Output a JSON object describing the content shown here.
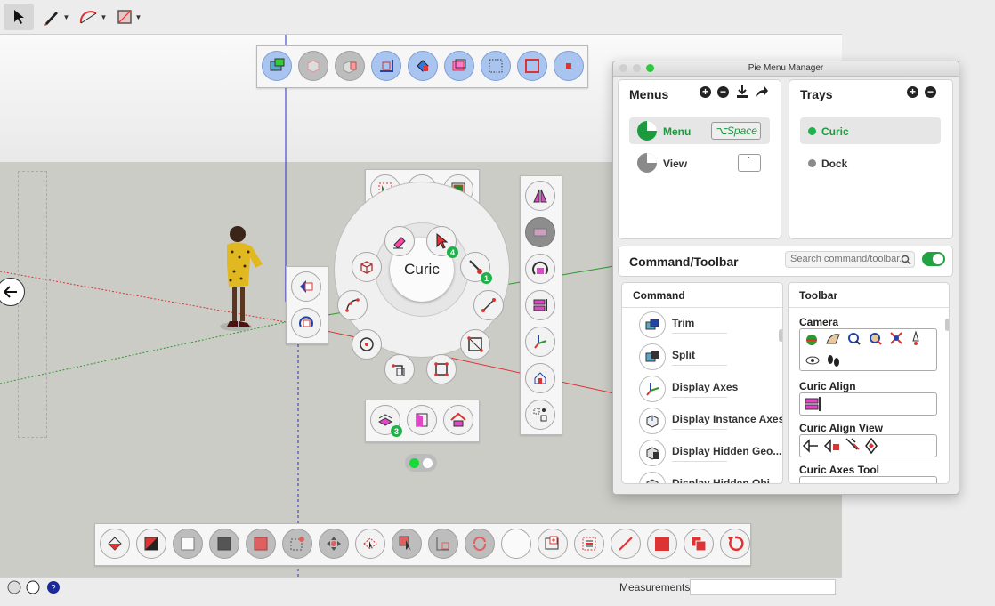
{
  "pie": {
    "center_label": "Curic"
  },
  "status_bar": {
    "measurements_label": "Measurements",
    "measurements_value": ""
  },
  "manager": {
    "window_title": "Pie Menu Manager",
    "menus": {
      "title": "Menus",
      "items": [
        {
          "label": "Menu",
          "shortcut": "⌥Space",
          "selected": true
        },
        {
          "label": "View",
          "shortcut": "`",
          "selected": false
        }
      ]
    },
    "trays": {
      "title": "Trays",
      "items": [
        {
          "label": "Curic",
          "color": "#1fb24a",
          "selected": true
        },
        {
          "label": "Dock",
          "color": "#8a8a8a",
          "selected": false
        }
      ]
    },
    "command_toolbar": {
      "title": "Command/Toolbar",
      "search_placeholder": "Search command/toolbar...",
      "toggle_on": true,
      "command_header": "Command",
      "toolbar_header": "Toolbar",
      "commands": [
        "Trim",
        "Split",
        "Display Axes",
        "Display Instance Axes",
        "Display Hidden Geo...",
        "Display Hidden Obj..."
      ],
      "toolbars": [
        "Camera",
        "Curic Align",
        "Curic Align View",
        "Curic Axes Tool"
      ]
    }
  },
  "colors": {
    "accent_green": "#1fb24a",
    "axis_red": "#d33",
    "axis_green": "#2a9a2a",
    "axis_blue": "#2b2bd0",
    "icon_magenta": "#e046c8"
  }
}
